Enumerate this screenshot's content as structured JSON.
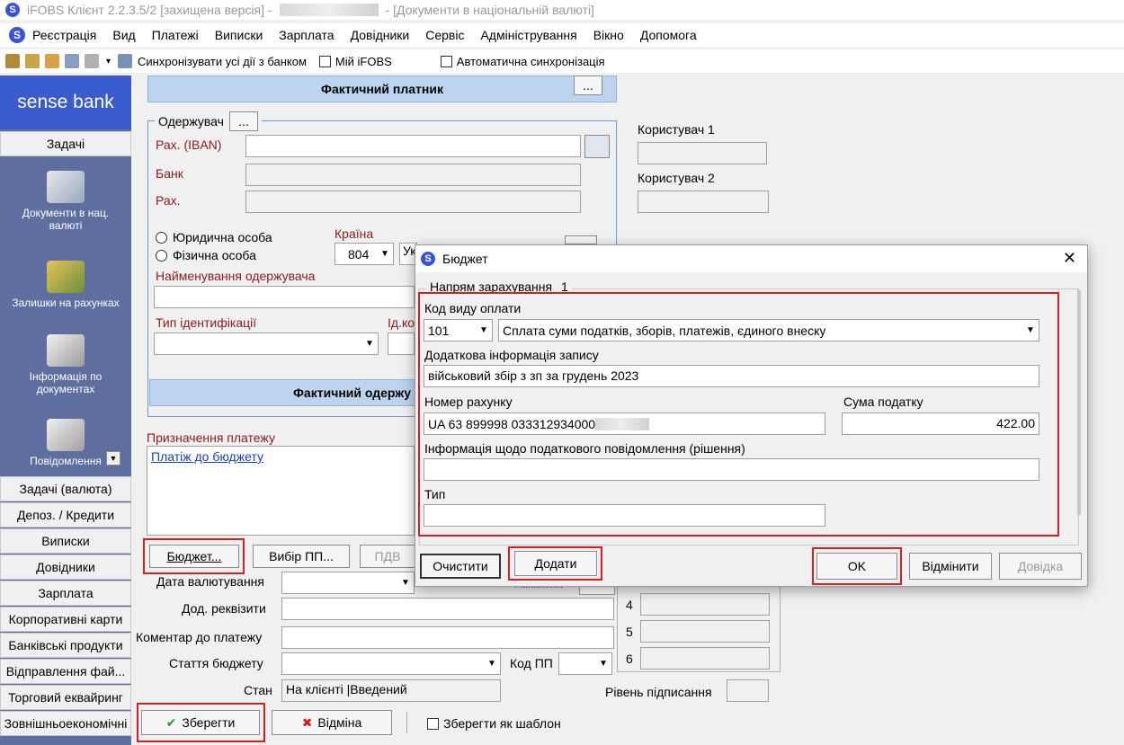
{
  "window": {
    "title": "iFOBS Клієнт 2.2.3.5/2 [захищена версія] -",
    "title_suffix": "- [Документи в національній валюті]"
  },
  "menu": [
    "Реєстрація",
    "Вид",
    "Платежі",
    "Виписки",
    "Зарплата",
    "Довідники",
    "Сервіс",
    "Адміністрування",
    "Вікно",
    "Допомога"
  ],
  "toolbar": {
    "sync_all": "Синхронізувати усі дії з банком",
    "my_ifobs": "Мій iFOBS",
    "auto_sync": "Автоматична синхронізація"
  },
  "sidebar": {
    "brand": "sense bank",
    "tasks_tab": "Задачі",
    "items": [
      {
        "label": "Документи в нац. валюті",
        "icon": "documents-icon"
      },
      {
        "label": "Залишки на рахунках",
        "icon": "money-icon"
      },
      {
        "label": "Інформація по документах",
        "icon": "info-docs-icon"
      },
      {
        "label": "Повідомлення",
        "icon": "messages-icon"
      }
    ],
    "tabs": [
      "Задачі (валюта)",
      "Депоз. / Кредити",
      "Виписки",
      "Довідники",
      "Зарплата",
      "Корпоративні карти",
      "Банківські продукти",
      "Відправлення фай...",
      "Торговий еквайринг",
      "Зовнішньоекономічні"
    ]
  },
  "form": {
    "actual_payer": "Фактичний платник",
    "ellipsis": "...",
    "receiver_group": "Одержувач",
    "iban_label": "Рах. (IBAN)",
    "bank_label": "Банк",
    "acc_label": "Рах.",
    "user1": "Користувач 1",
    "user2": "Користувач 2",
    "legal_entity": "Юридична особа",
    "individual": "Фізична особа",
    "country_label": "Країна",
    "country_code": "804",
    "country_name": "Ук",
    "receiver_name_label": "Найменування одержувача",
    "id_type_label": "Тип ідентифікації",
    "id_code_label": "Ід.ко",
    "actual_receiver": "Фактичний одержу",
    "purpose_label": "Призначення платежу",
    "purpose_value": "Платіж до бюджету",
    "budget_btn": "Бюджет...",
    "choose_pp_btn": "Вибір ПП...",
    "pdv_btn": "ПДВ",
    "value_date_label": "Дата валютування",
    "priority_label": "Пріоритет",
    "add_req_label": "Дод. реквізити",
    "comment_label": "Коментар до платежу",
    "budget_article_label": "Стаття бюджету",
    "code_pp_label": "Код ПП",
    "state_label": "Стан",
    "state_value": "На клієнті |Введений",
    "sign_level_label": "Рівень підписання",
    "row_nums": [
      "4",
      "5",
      "6"
    ],
    "save_btn": "Зберегти",
    "cancel_btn": "Відміна",
    "save_template": "Зберегти як шаблон"
  },
  "dialog": {
    "title": "Бюджет",
    "group_label": "Напрям зарахування",
    "group_num": "1",
    "pay_code_label": "Код виду оплати",
    "pay_code": "101",
    "pay_desc": "Сплата суми податків, зборів, платежів, єдиного внеску",
    "add_info_label": "Додаткова інформація запису",
    "add_info_value": "військовий збір з зп за грудень 2023",
    "acc_num_label": "Номер рахунку",
    "acc_num_value": "UA 63 899998 033312934000",
    "tax_sum_label": "Сума податку",
    "tax_sum_value": "422.00",
    "tax_notice_label": "Інформація щодо податкового повідомлення (рішення)",
    "type_label": "Тип",
    "clear_btn": "Очистити",
    "add_btn": "Додати",
    "ok_btn": "OK",
    "cancel_btn": "Відмінити",
    "help_btn": "Довідка"
  },
  "colors": {
    "sidebar_bg": "#5e6e9f",
    "brand_bg": "#3b5ccc",
    "highlight_red": "#d21f1f",
    "panel_head": "#bcd4ee",
    "label_red": "#8b1a1a"
  }
}
